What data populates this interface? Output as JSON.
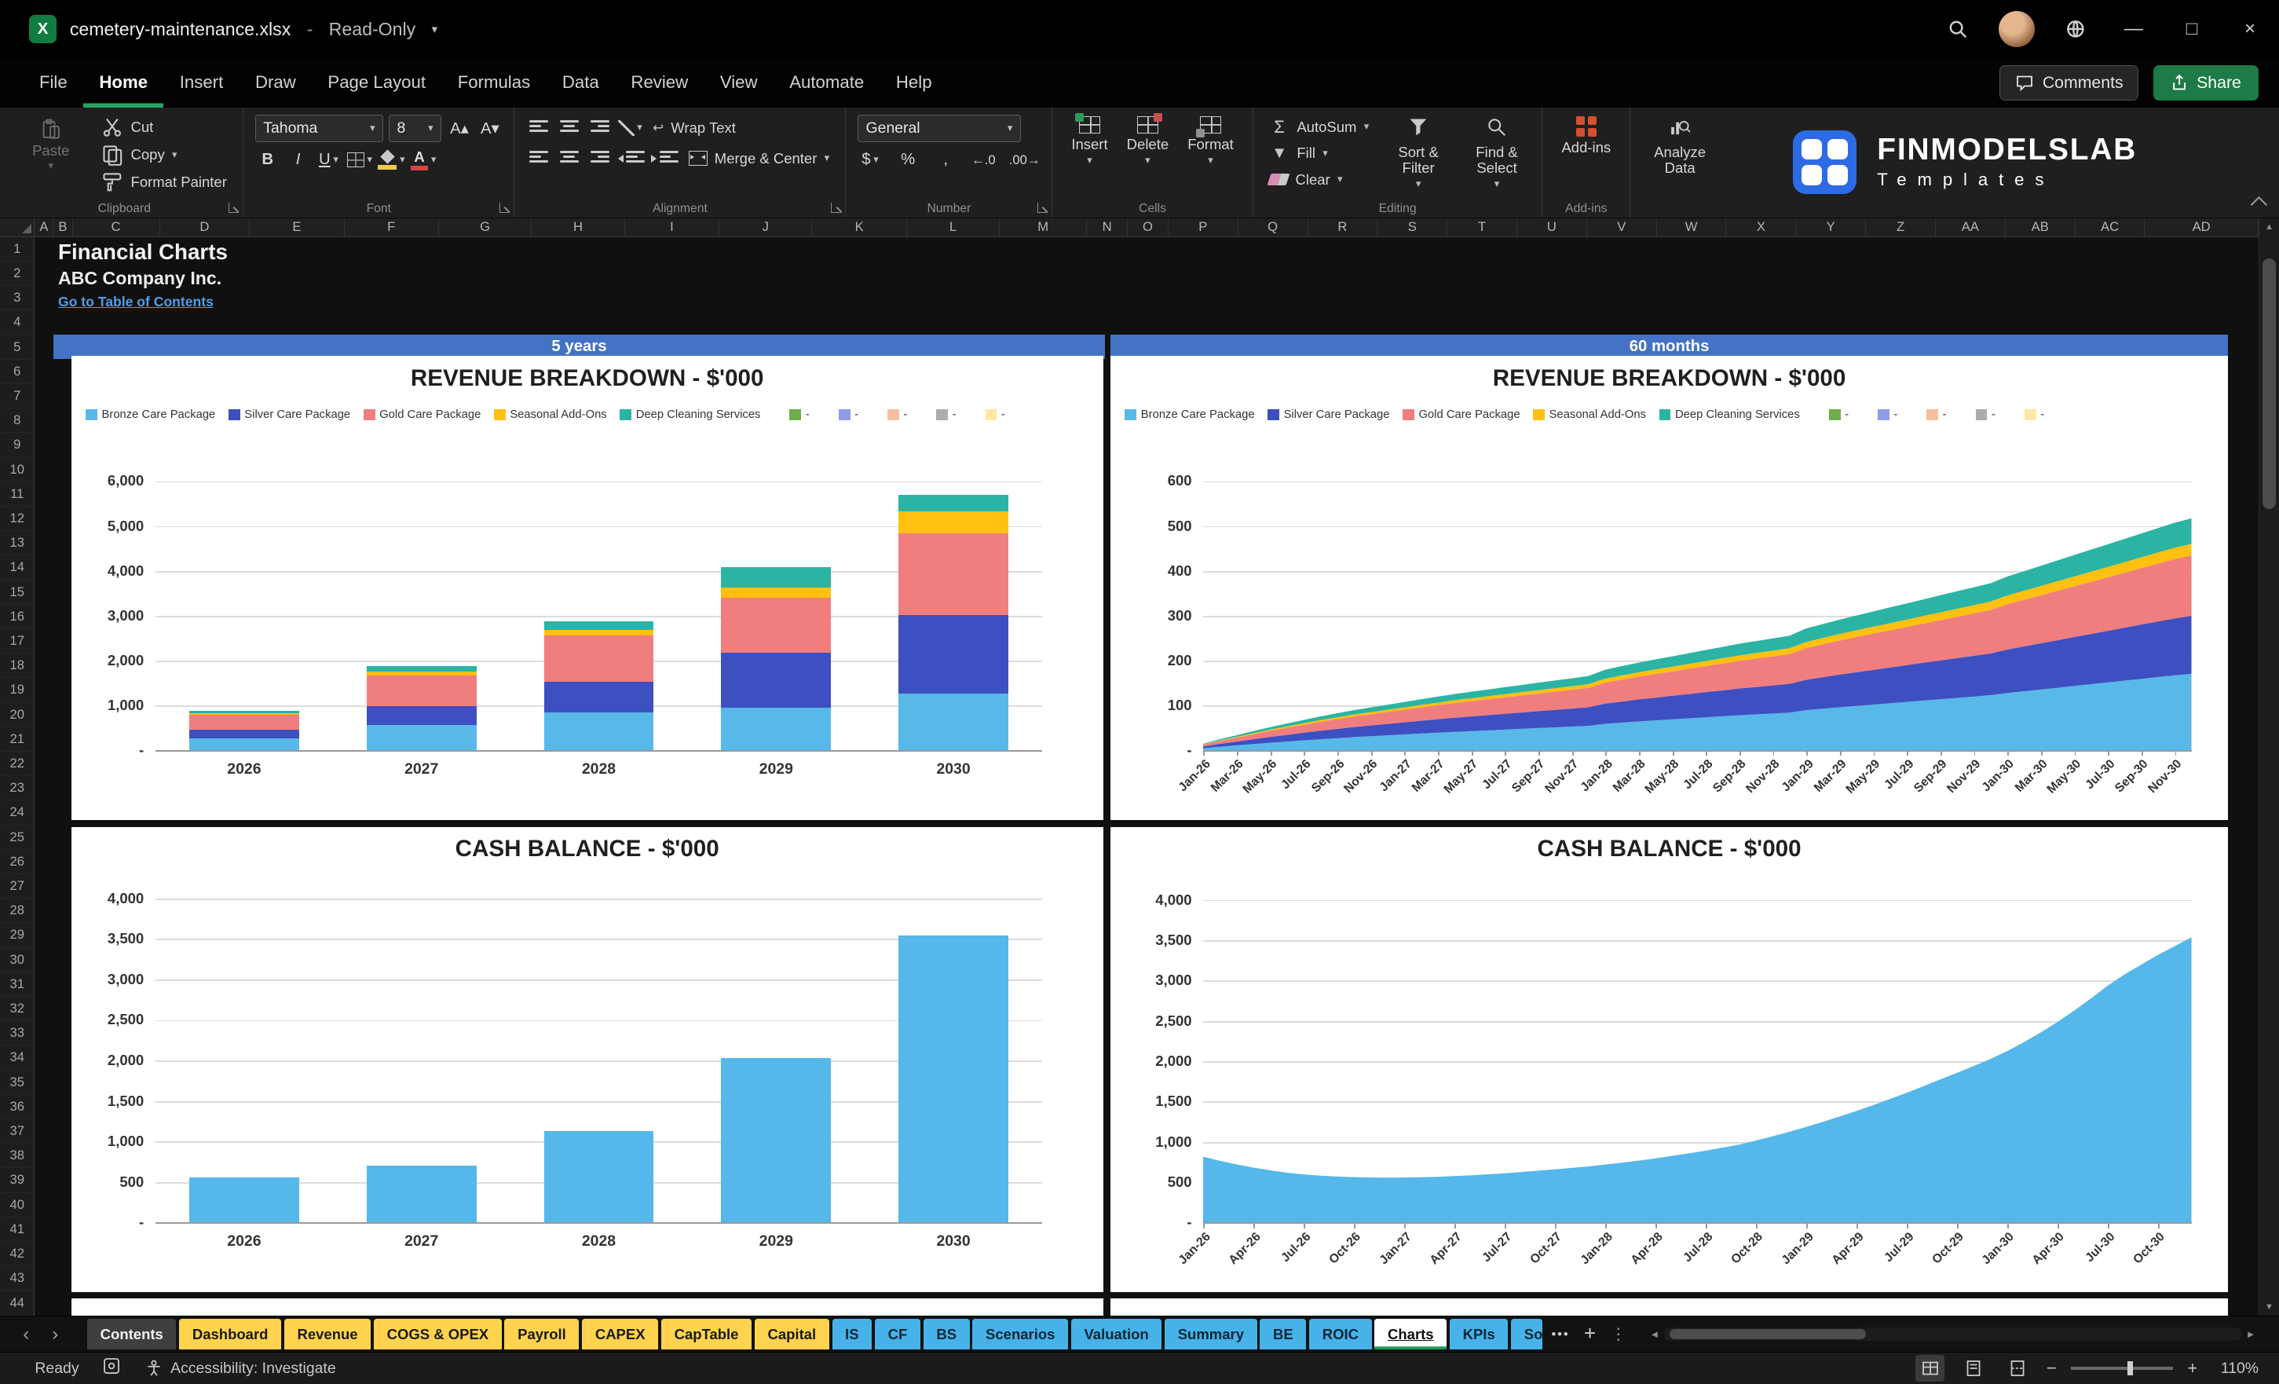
{
  "titlebar": {
    "filename": "cemetery-maintenance.xlsx",
    "separator": "-",
    "mode": "Read-Only"
  },
  "menubar": {
    "items": [
      "File",
      "Home",
      "Insert",
      "Draw",
      "Page Layout",
      "Formulas",
      "Data",
      "Review",
      "View",
      "Automate",
      "Help"
    ],
    "active_item": "Home",
    "comments": "Comments",
    "share": "Share"
  },
  "ribbon": {
    "clipboard": {
      "label": "Clipboard",
      "paste": "Paste",
      "cut": "Cut",
      "copy": "Copy",
      "format_painter": "Format Painter"
    },
    "font": {
      "label": "Font",
      "family": "Tahoma",
      "size": "8",
      "bold": "B",
      "italic": "I",
      "underline": "U"
    },
    "alignment": {
      "label": "Alignment",
      "wrap_text": "Wrap Text",
      "merge_center": "Merge & Center"
    },
    "number": {
      "label": "Number",
      "format": "General",
      "currency": "$",
      "percent": "%",
      "comma": ",",
      "inc_decimal": "←.0",
      "dec_decimal": ".00→"
    },
    "cells": {
      "label": "Cells",
      "insert": "Insert",
      "delete": "Delete",
      "format": "Format"
    },
    "editing": {
      "label": "Editing",
      "autosum_glyph": "Σ",
      "autosum": "AutoSum",
      "fill": "Fill",
      "clear": "Clear",
      "sort_filter": "Sort & Filter",
      "find_select": "Find & Select"
    },
    "addins": {
      "label": "Add-ins",
      "button": "Add-ins"
    },
    "analyze": {
      "button": "Analyze Data"
    },
    "brand": {
      "name": "FINMODELSLAB",
      "sub": "Templates"
    }
  },
  "grid": {
    "columns": [
      "A",
      "B",
      "C",
      "D",
      "E",
      "F",
      "G",
      "H",
      "I",
      "J",
      "K",
      "L",
      "M",
      "N",
      "O",
      "P",
      "Q",
      "R",
      "S",
      "T",
      "U",
      "V",
      "W",
      "X",
      "Y",
      "Z",
      "AA",
      "AB",
      "AC",
      "AD"
    ],
    "rows": [
      1,
      2,
      3,
      4,
      5,
      6,
      7,
      8,
      9,
      10,
      11,
      12,
      13,
      14,
      15,
      16,
      17,
      18,
      19,
      20,
      21,
      22,
      23,
      24,
      25,
      26,
      27,
      28,
      29,
      30,
      31,
      32,
      33,
      34,
      35,
      36,
      37,
      38,
      39,
      40,
      41,
      42,
      43,
      44
    ]
  },
  "sheet": {
    "title": "Financial Charts",
    "company": "ABC Company Inc.",
    "link": "Go to Table of Contents",
    "left_period": "5 years",
    "right_period": "60 months"
  },
  "chart_data": [
    {
      "id": "revenue_breakdown_annual",
      "type": "stacked-bar",
      "title": "REVENUE BREAKDOWN - $'000",
      "categories": [
        "2026",
        "2027",
        "2028",
        "2029",
        "2030"
      ],
      "series": [
        {
          "name": "Bronze Care Package",
          "color": "#58B8E8",
          "values": [
            260,
            560,
            840,
            940,
            1270
          ]
        },
        {
          "name": "Silver Care Package",
          "color": "#3E4FC1",
          "values": [
            190,
            420,
            680,
            1230,
            1750
          ]
        },
        {
          "name": "Gold Care Package",
          "color": "#F07E7E",
          "values": [
            330,
            680,
            1030,
            1230,
            1820
          ]
        },
        {
          "name": "Seasonal Add-Ons",
          "color": "#FFC010",
          "values": [
            40,
            90,
            130,
            230,
            490
          ]
        },
        {
          "name": "Deep Cleaning Services",
          "color": "#2BB4A4",
          "values": [
            60,
            130,
            200,
            460,
            360
          ]
        }
      ],
      "extra_legend": [
        {
          "label": "-",
          "color": "#70AD47"
        },
        {
          "label": "-",
          "color": "#8E9CE8"
        },
        {
          "label": "-",
          "color": "#F6BF9F"
        },
        {
          "label": "-",
          "color": "#ACACAC"
        },
        {
          "label": "-",
          "color": "#FFE8A6"
        }
      ],
      "y_ticks": [
        "6,000",
        "5,000",
        "4,000",
        "3,000",
        "2,000",
        "1,000",
        "-"
      ],
      "ymax": 6000,
      "xlabel": "",
      "ylabel": ""
    },
    {
      "id": "revenue_breakdown_monthly",
      "type": "stacked-area",
      "title": "REVENUE BREAKDOWN - $'000",
      "x": [
        "Jan-26",
        "Feb-26",
        "Mar-26",
        "Apr-26",
        "May-26",
        "Jun-26",
        "Jul-26",
        "Aug-26",
        "Sep-26",
        "Oct-26",
        "Nov-26",
        "Dec-26",
        "Jan-27",
        "Feb-27",
        "Mar-27",
        "Apr-27",
        "May-27",
        "Jun-27",
        "Jul-27",
        "Aug-27",
        "Sep-27",
        "Oct-27",
        "Nov-27",
        "Dec-27",
        "Jan-28",
        "Feb-28",
        "Mar-28",
        "Apr-28",
        "May-28",
        "Jun-28",
        "Jul-28",
        "Aug-28",
        "Sep-28",
        "Oct-28",
        "Nov-28",
        "Dec-28",
        "Jan-29",
        "Feb-29",
        "Mar-29",
        "Apr-29",
        "May-29",
        "Jun-29",
        "Jul-29",
        "Aug-29",
        "Sep-29",
        "Oct-29",
        "Nov-29",
        "Dec-29",
        "Jan-30",
        "Feb-30",
        "Mar-30",
        "Apr-30",
        "May-30",
        "Jun-30",
        "Jul-30",
        "Aug-30",
        "Sep-30",
        "Oct-30",
        "Nov-30",
        "Dec-30"
      ],
      "tick_every": 2,
      "totals": [
        15,
        25,
        34,
        43,
        52,
        60,
        68,
        76,
        83,
        90,
        96,
        102,
        108,
        114,
        120,
        126,
        131,
        136,
        141,
        146,
        151,
        156,
        161,
        166,
        180,
        188,
        196,
        203,
        210,
        217,
        224,
        231,
        238,
        244,
        250,
        256,
        272,
        282,
        292,
        301,
        310,
        319,
        328,
        337,
        346,
        355,
        364,
        373,
        388,
        400,
        412,
        424,
        436,
        448,
        460,
        472,
        484,
        496,
        508,
        518
      ],
      "series": [
        {
          "name": "Bronze Care Package",
          "color": "#58B8E8",
          "share": 0.33
        },
        {
          "name": "Silver Care Package",
          "color": "#3E4FC1",
          "share": 0.25
        },
        {
          "name": "Gold Care Package",
          "color": "#F07E7E",
          "share": 0.26
        },
        {
          "name": "Seasonal Add-Ons",
          "color": "#FFC010",
          "share": 0.05
        },
        {
          "name": "Deep Cleaning Services",
          "color": "#2BB4A4",
          "share": 0.11
        }
      ],
      "extra_legend": [
        {
          "label": "-",
          "color": "#70AD47"
        },
        {
          "label": "-",
          "color": "#8E9CE8"
        },
        {
          "label": "-",
          "color": "#F6BF9F"
        },
        {
          "label": "-",
          "color": "#ACACAC"
        },
        {
          "label": "-",
          "color": "#FFE8A6"
        }
      ],
      "y_ticks": [
        "600",
        "500",
        "400",
        "300",
        "200",
        "100",
        "-"
      ],
      "ymax": 600
    },
    {
      "id": "cash_balance_annual",
      "type": "bar",
      "title": "CASH BALANCE - $'000",
      "categories": [
        "2026",
        "2027",
        "2028",
        "2029",
        "2030"
      ],
      "values": [
        560,
        700,
        1130,
        2030,
        3540
      ],
      "color": "#55B7EA",
      "y_ticks": [
        "4,000",
        "3,500",
        "3,000",
        "2,500",
        "2,000",
        "1,500",
        "1,000",
        "500",
        "-"
      ],
      "ymax": 4000
    },
    {
      "id": "cash_balance_monthly",
      "type": "area",
      "title": "CASH BALANCE - $'000",
      "x": [
        "Jan-26",
        "Feb-26",
        "Mar-26",
        "Apr-26",
        "May-26",
        "Jun-26",
        "Jul-26",
        "Aug-26",
        "Sep-26",
        "Oct-26",
        "Nov-26",
        "Dec-26",
        "Jan-27",
        "Feb-27",
        "Mar-27",
        "Apr-27",
        "May-27",
        "Jun-27",
        "Jul-27",
        "Aug-27",
        "Sep-27",
        "Oct-27",
        "Nov-27",
        "Dec-27",
        "Jan-28",
        "Feb-28",
        "Mar-28",
        "Apr-28",
        "May-28",
        "Jun-28",
        "Jul-28",
        "Aug-28",
        "Sep-28",
        "Oct-28",
        "Nov-28",
        "Dec-28",
        "Jan-29",
        "Feb-29",
        "Mar-29",
        "Apr-29",
        "May-29",
        "Jun-29",
        "Jul-29",
        "Aug-29",
        "Sep-29",
        "Oct-29",
        "Nov-29",
        "Dec-29",
        "Jan-30",
        "Feb-30",
        "Mar-30",
        "Apr-30",
        "May-30",
        "Jun-30",
        "Jul-30",
        "Aug-30",
        "Sep-30",
        "Oct-30",
        "Nov-30",
        "Dec-30"
      ],
      "tick_every": 3,
      "values": [
        820,
        770,
        725,
        685,
        650,
        622,
        600,
        585,
        575,
        568,
        562,
        560,
        562,
        566,
        572,
        580,
        590,
        602,
        615,
        630,
        646,
        663,
        681,
        700,
        722,
        746,
        772,
        800,
        830,
        862,
        896,
        932,
        970,
        1020,
        1073,
        1130,
        1190,
        1253,
        1319,
        1388,
        1460,
        1535,
        1613,
        1694,
        1778,
        1860,
        1944,
        2030,
        2130,
        2240,
        2360,
        2490,
        2630,
        2780,
        2940,
        3080,
        3200,
        3320,
        3430,
        3540
      ],
      "color": "#55B7EA",
      "y_ticks": [
        "4,000",
        "3,500",
        "3,000",
        "2,500",
        "2,000",
        "1,500",
        "1,000",
        "500",
        "-"
      ],
      "ymax": 4000
    }
  ],
  "sheet_tabs": {
    "active": "Charts",
    "tabs": [
      {
        "label": "Contents",
        "bg": "#3f3f3f",
        "fg": "#f2f2f2"
      },
      {
        "label": "Dashboard",
        "bg": "#FFD34D",
        "fg": "#1a1a1a"
      },
      {
        "label": "Revenue",
        "bg": "#FFD34D",
        "fg": "#1a1a1a"
      },
      {
        "label": "COGS & OPEX",
        "bg": "#FFD34D",
        "fg": "#1a1a1a"
      },
      {
        "label": "Payroll",
        "bg": "#FFD34D",
        "fg": "#1a1a1a"
      },
      {
        "label": "CAPEX",
        "bg": "#FFD34D",
        "fg": "#1a1a1a"
      },
      {
        "label": "CapTable",
        "bg": "#FFD34D",
        "fg": "#1a1a1a"
      },
      {
        "label": "Capital",
        "bg": "#FFD34D",
        "fg": "#1a1a1a"
      },
      {
        "label": "IS",
        "bg": "#46B2E9",
        "fg": "#0d2634"
      },
      {
        "label": "CF",
        "bg": "#46B2E9",
        "fg": "#0d2634"
      },
      {
        "label": "BS",
        "bg": "#46B2E9",
        "fg": "#0d2634"
      },
      {
        "label": "Scenarios",
        "bg": "#46B2E9",
        "fg": "#0d2634"
      },
      {
        "label": "Valuation",
        "bg": "#46B2E9",
        "fg": "#0d2634"
      },
      {
        "label": "Summary",
        "bg": "#46B2E9",
        "fg": "#0d2634"
      },
      {
        "label": "BE",
        "bg": "#46B2E9",
        "fg": "#0d2634"
      },
      {
        "label": "ROIC",
        "bg": "#46B2E9",
        "fg": "#0d2634"
      },
      {
        "label": "Charts",
        "bg": "#ffffff",
        "fg": "#111111"
      },
      {
        "label": "KPIs",
        "bg": "#46B2E9",
        "fg": "#0d2634"
      },
      {
        "label": "So",
        "bg": "#46B2E9",
        "fg": "#0d2634",
        "cut": true
      }
    ]
  },
  "statusbar": {
    "ready": "Ready",
    "accessibility": "Accessibility: Investigate",
    "zoom": "110%"
  },
  "icons": {
    "excel_x": "X",
    "chevron_down": "▾",
    "grow_font": "A▴",
    "shrink_font": "A▾",
    "font_color_letter": "A",
    "wrap_return": "↩",
    "minimize": "—",
    "maximize": "□",
    "close": "×",
    "nav_prev": "‹",
    "nav_next": "›",
    "more_tabs": "•••",
    "add_sheet": "+",
    "tab_options": "⋮",
    "scroll_up": "▲",
    "scroll_down": "▼",
    "scroll_left": "◄",
    "scroll_right": "►",
    "zoom_out": "−",
    "zoom_in": "+"
  }
}
